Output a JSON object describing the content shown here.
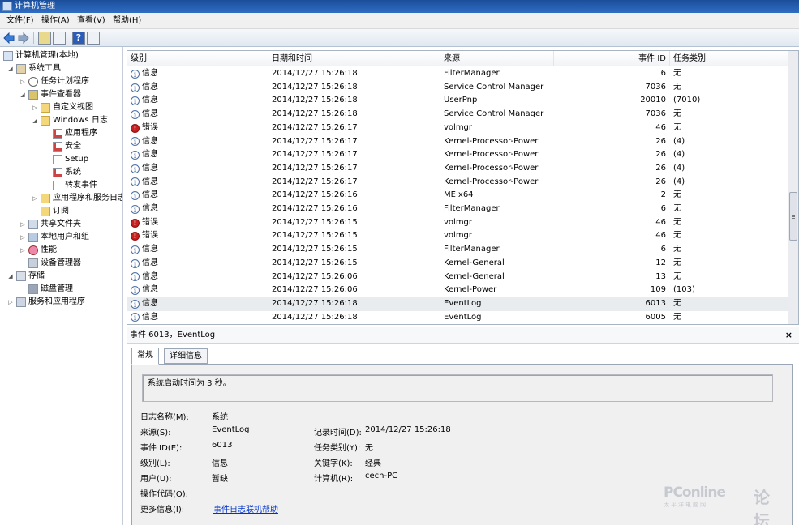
{
  "window": {
    "title": "计算机管理"
  },
  "menu": [
    "文件(F)",
    "操作(A)",
    "查看(V)",
    "帮助(H)"
  ],
  "tree": [
    {
      "label": "计算机管理(本地)",
      "icon": "computer-icon"
    },
    {
      "label": "系统工具",
      "icon": "tools-icon"
    },
    {
      "label": "任务计划程序",
      "icon": "clock-icon"
    },
    {
      "label": "事件查看器",
      "icon": "event-viewer-icon"
    },
    {
      "label": "自定义视图",
      "icon": "folder-icon"
    },
    {
      "label": "Windows 日志",
      "icon": "folder-icon"
    },
    {
      "label": "应用程序",
      "icon": "log-icon"
    },
    {
      "label": "安全",
      "icon": "log-icon"
    },
    {
      "label": "Setup",
      "icon": "log-icon"
    },
    {
      "label": "系统",
      "icon": "log-icon"
    },
    {
      "label": "转发事件",
      "icon": "log-icon"
    },
    {
      "label": "应用程序和服务日志",
      "icon": "folder-icon"
    },
    {
      "label": "订阅",
      "icon": "subscription-icon"
    },
    {
      "label": "共享文件夹",
      "icon": "shared-folder-icon"
    },
    {
      "label": "本地用户和组",
      "icon": "users-icon"
    },
    {
      "label": "性能",
      "icon": "performance-icon"
    },
    {
      "label": "设备管理器",
      "icon": "device-manager-icon"
    },
    {
      "label": "存储",
      "icon": "storage-icon"
    },
    {
      "label": "磁盘管理",
      "icon": "disk-icon"
    },
    {
      "label": "服务和应用程序",
      "icon": "services-icon"
    }
  ],
  "events": {
    "columns": [
      "级别",
      "日期和时间",
      "来源",
      "事件 ID",
      "任务类别"
    ],
    "rows": [
      {
        "level": "信息",
        "time": "2014/12/27 15:26:18",
        "source": "FilterManager",
        "id": "6",
        "category": "无"
      },
      {
        "level": "信息",
        "time": "2014/12/27 15:26:18",
        "source": "Service Control Manager",
        "id": "7036",
        "category": "无"
      },
      {
        "level": "信息",
        "time": "2014/12/27 15:26:18",
        "source": "UserPnp",
        "id": "20010",
        "category": "(7010)"
      },
      {
        "level": "信息",
        "time": "2014/12/27 15:26:18",
        "source": "Service Control Manager",
        "id": "7036",
        "category": "无"
      },
      {
        "level": "错误",
        "time": "2014/12/27 15:26:17",
        "source": "volmgr",
        "id": "46",
        "category": "无"
      },
      {
        "level": "信息",
        "time": "2014/12/27 15:26:17",
        "source": "Kernel-Processor-Power",
        "id": "26",
        "category": "(4)"
      },
      {
        "level": "信息",
        "time": "2014/12/27 15:26:17",
        "source": "Kernel-Processor-Power",
        "id": "26",
        "category": "(4)"
      },
      {
        "level": "信息",
        "time": "2014/12/27 15:26:17",
        "source": "Kernel-Processor-Power",
        "id": "26",
        "category": "(4)"
      },
      {
        "level": "信息",
        "time": "2014/12/27 15:26:17",
        "source": "Kernel-Processor-Power",
        "id": "26",
        "category": "(4)"
      },
      {
        "level": "信息",
        "time": "2014/12/27 15:26:16",
        "source": "MEIx64",
        "id": "2",
        "category": "无"
      },
      {
        "level": "信息",
        "time": "2014/12/27 15:26:16",
        "source": "FilterManager",
        "id": "6",
        "category": "无"
      },
      {
        "level": "错误",
        "time": "2014/12/27 15:26:15",
        "source": "volmgr",
        "id": "46",
        "category": "无"
      },
      {
        "level": "错误",
        "time": "2014/12/27 15:26:15",
        "source": "volmgr",
        "id": "46",
        "category": "无"
      },
      {
        "level": "信息",
        "time": "2014/12/27 15:26:15",
        "source": "FilterManager",
        "id": "6",
        "category": "无"
      },
      {
        "level": "信息",
        "time": "2014/12/27 15:26:15",
        "source": "Kernel-General",
        "id": "12",
        "category": "无"
      },
      {
        "level": "信息",
        "time": "2014/12/27 15:26:06",
        "source": "Kernel-General",
        "id": "13",
        "category": "无"
      },
      {
        "level": "信息",
        "time": "2014/12/27 15:26:06",
        "source": "Kernel-Power",
        "id": "109",
        "category": "(103)"
      },
      {
        "level": "信息",
        "time": "2014/12/27 15:26:18",
        "source": "EventLog",
        "id": "6013",
        "category": "无"
      },
      {
        "level": "信息",
        "time": "2014/12/27 15:26:18",
        "source": "EventLog",
        "id": "6005",
        "category": "无"
      }
    ],
    "selected_index": 17
  },
  "detail": {
    "title": "事件 6013，EventLog",
    "close": "×",
    "tabs": [
      "常规",
      "详细信息"
    ],
    "description": "系统启动时间为 3 秒。",
    "fields": {
      "log_name_label": "日志名称(M):",
      "log_name": "系统",
      "source_label": "来源(S):",
      "source": "EventLog",
      "logged_label": "记录时间(D):",
      "logged": "2014/12/27 15:26:18",
      "event_id_label": "事件 ID(E):",
      "event_id": "6013",
      "task_label": "任务类别(Y):",
      "task": "无",
      "level_label": "级别(L):",
      "level": "信息",
      "keywords_label": "关键字(K):",
      "keywords": "经典",
      "user_label": "用户(U):",
      "user": "暂缺",
      "computer_label": "计算机(R):",
      "computer": "cech-PC",
      "opcode_label": "操作代码(O):",
      "more_label": "更多信息(I):",
      "more_link": "事件日志联机帮助"
    }
  },
  "watermark": {
    "brand": "PConline",
    "sub": "太平洋电脑网",
    "forum": "论坛"
  }
}
